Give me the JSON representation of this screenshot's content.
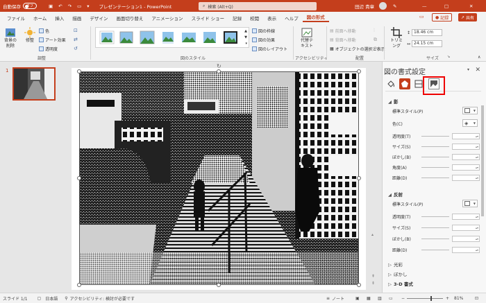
{
  "titlebar": {
    "autosave_label": "自動保存",
    "autosave_state": "オフ",
    "title": "プレゼンテーション1 - PowerPoint",
    "search_placeholder": "検索 (Alt+Q)",
    "user_name": "田辺 貴章"
  },
  "tabs": [
    {
      "label": "ファイル"
    },
    {
      "label": "ホーム"
    },
    {
      "label": "挿入"
    },
    {
      "label": "描画"
    },
    {
      "label": "デザイン"
    },
    {
      "label": "画面切り替え"
    },
    {
      "label": "アニメーション"
    },
    {
      "label": "スライド ショー"
    },
    {
      "label": "記録"
    },
    {
      "label": "校閲"
    },
    {
      "label": "表示"
    },
    {
      "label": "ヘルプ"
    },
    {
      "label": "図の形式"
    }
  ],
  "tab_actions": {
    "record": "記録",
    "share": "共有"
  },
  "ribbon": {
    "remove_bg": "背景の削除",
    "corrections": "修整",
    "color": "色",
    "artistic": "アート効果",
    "transparency": "透明度",
    "adjust_group": "調整",
    "styles_group": "図のスタイル",
    "picture_border": "図の枠線",
    "picture_effects": "図の効果",
    "picture_layout": "図のレイアウト",
    "alt_text": "代替テキスト",
    "accessibility_group": "アクセシビリティ",
    "bring_forward": "前面へ移動",
    "send_backward": "背面へ移動",
    "selection_pane": "オブジェクトの選択と表示",
    "arrange_group": "配置",
    "crop": "トリミング",
    "height": "18.46 cm",
    "width": "24.15 cm",
    "size_group": "サイズ"
  },
  "slides": {
    "number": "1"
  },
  "format_panel": {
    "title": "図の書式設定",
    "shadow": {
      "title": "影",
      "rows": [
        {
          "label": "標準スタイル(P)"
        },
        {
          "label": "色(C)"
        },
        {
          "label": "透明度(T)"
        },
        {
          "label": "サイズ(S)"
        },
        {
          "label": "ぼかし(B)"
        },
        {
          "label": "角度(A)"
        },
        {
          "label": "距離(D)"
        }
      ]
    },
    "reflection": {
      "title": "反射",
      "rows": [
        {
          "label": "標準スタイル(P)"
        },
        {
          "label": "透明度(T)"
        },
        {
          "label": "サイズ(S)"
        },
        {
          "label": "ぼかし(B)"
        },
        {
          "label": "距離(D)"
        }
      ]
    },
    "glow": "光彩",
    "soft_edges": "ぼかし",
    "three_d_format": "3-D 書式"
  },
  "statusbar": {
    "slide_info": "スライド 1/1",
    "language": "日本語",
    "accessibility": "アクセシビリティ: 検討が必要です",
    "notes": "ノート",
    "zoom": "81%"
  },
  "colors": {
    "accent": "#c43e1c",
    "highlight_box": "#e00000"
  }
}
